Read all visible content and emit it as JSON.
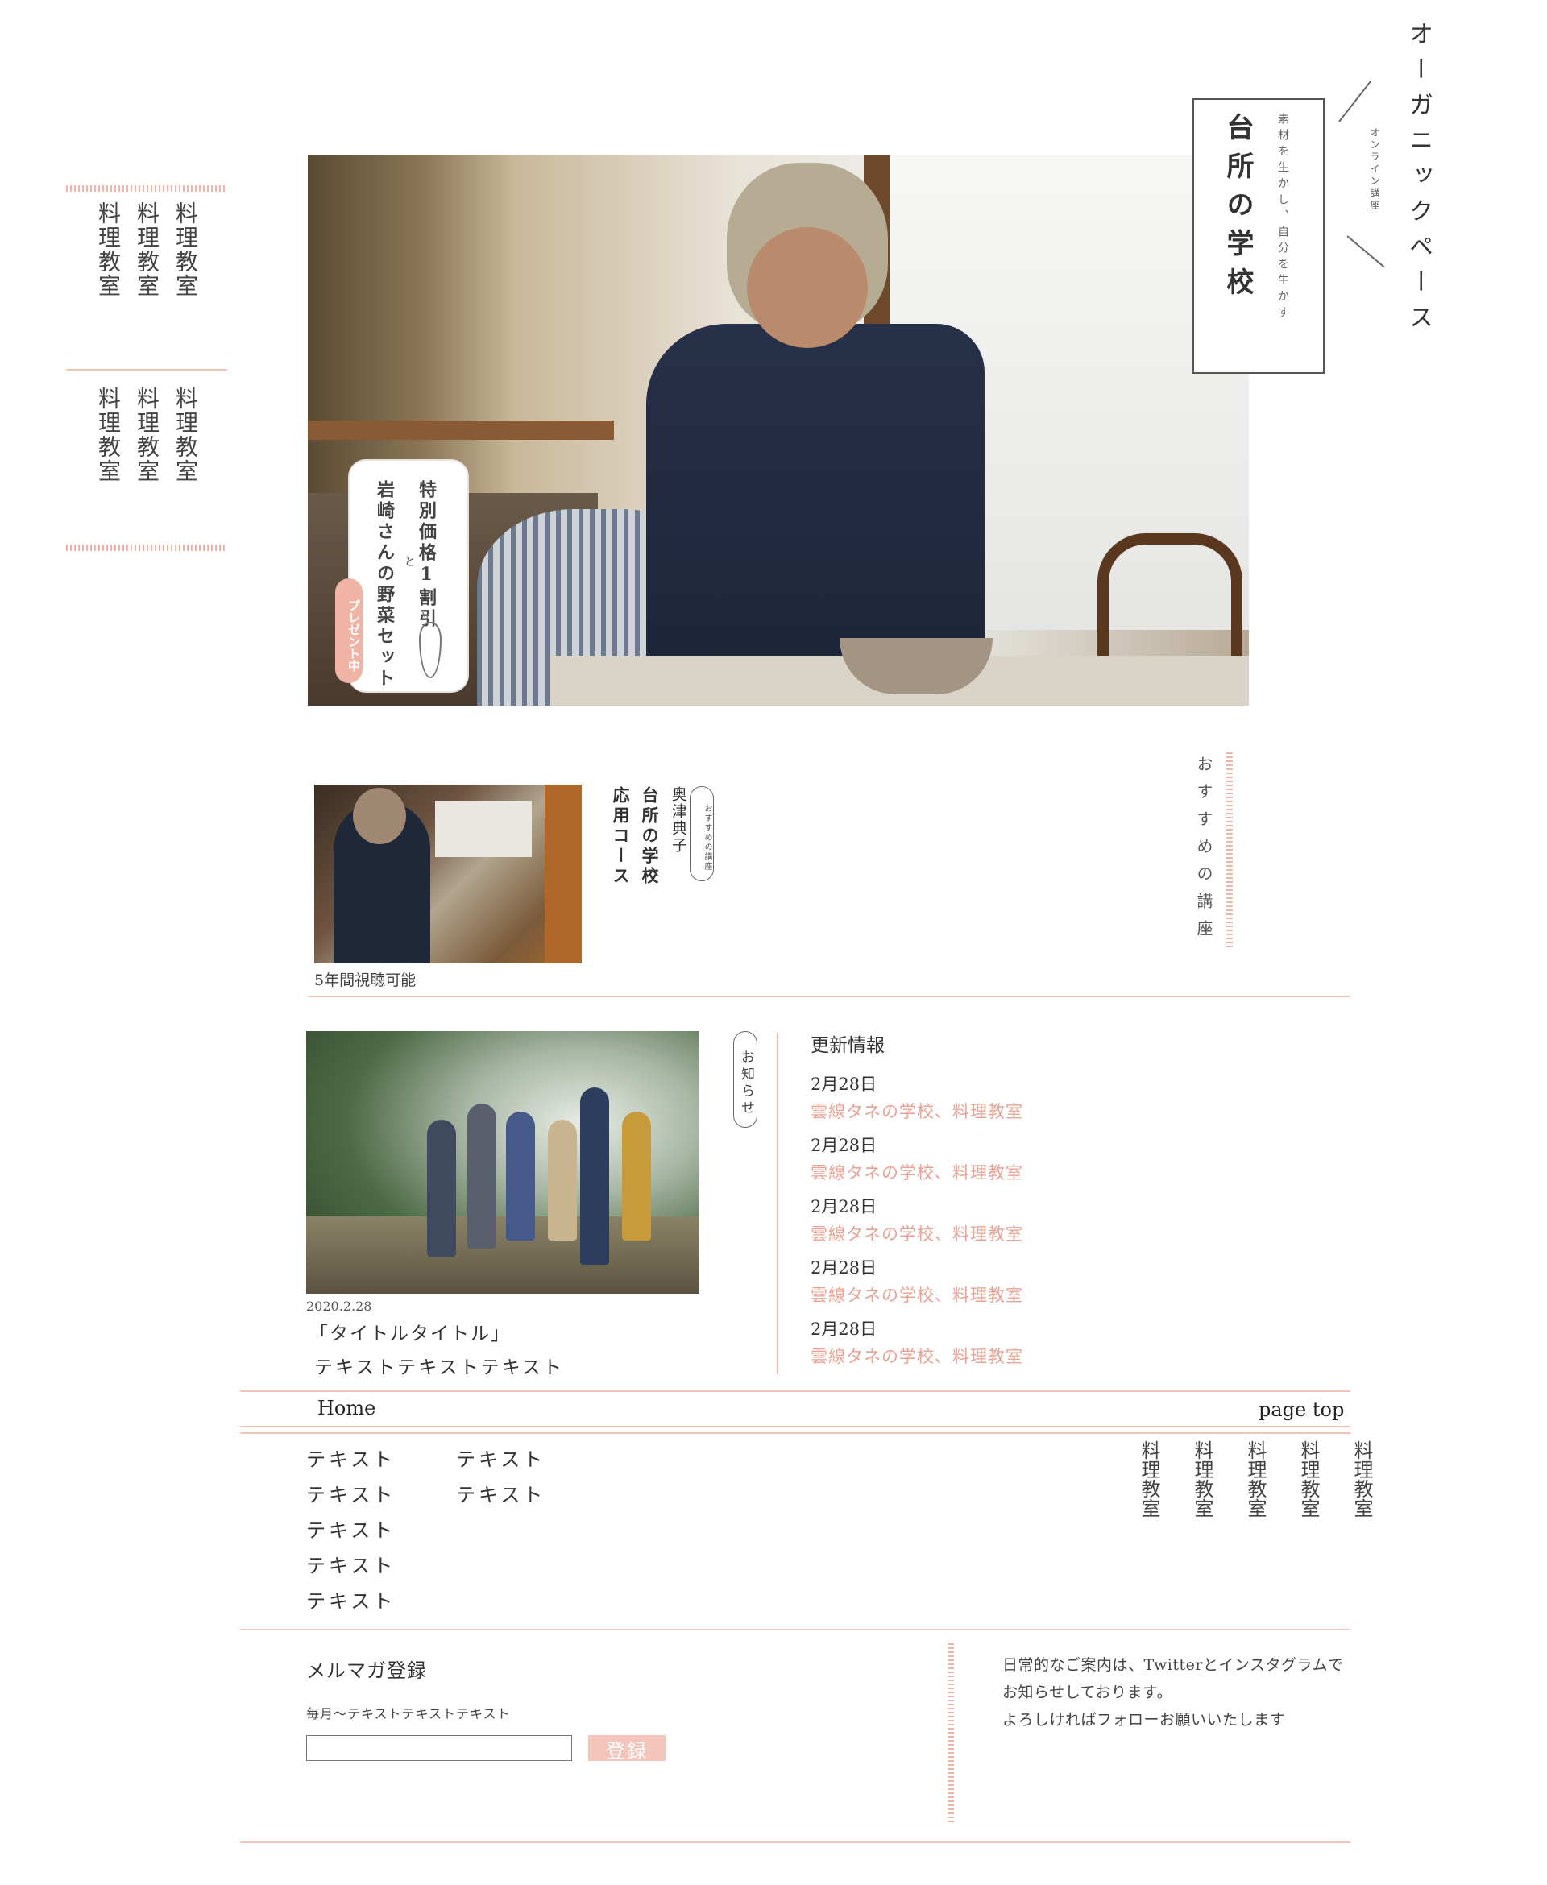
{
  "brand": {
    "name": "オーガニックペース",
    "logo_title": "台所の学校",
    "logo_subtitle": "素材を生かし、自分を生かす",
    "logo_tag": "オンライン講座"
  },
  "hero": {
    "promo_line1": "特別価格1割引",
    "promo_and": "と",
    "promo_line2": "岩崎さんの野菜セット",
    "promo_badge": "プレゼント中"
  },
  "left_menu": {
    "group1": [
      "料理教室",
      "料理教室",
      "料理教室"
    ],
    "group2": [
      "料理教室",
      "料理教室",
      "料理教室"
    ]
  },
  "recommended": {
    "section_label": "おすすめの講座",
    "tag": "おすすめの講座",
    "instructor": "奥津典子",
    "school": "台所の学校",
    "course": "応用コース",
    "caption": "5年間視聴可能"
  },
  "news": {
    "label": "お知らせ",
    "date": "2020.2.28",
    "title": "「タイトルタイトル」",
    "text": "テキストテキストテキスト"
  },
  "updates": {
    "heading": "更新情報",
    "items": [
      {
        "date": "2月28日",
        "link": "雲線タネの学校、料理教室"
      },
      {
        "date": "2月28日",
        "link": "雲線タネの学校、料理教室"
      },
      {
        "date": "2月28日",
        "link": "雲線タネの学校、料理教室"
      },
      {
        "date": "2月28日",
        "link": "雲線タネの学校、料理教室"
      },
      {
        "date": "2月28日",
        "link": "雲線タネの学校、料理教室"
      }
    ]
  },
  "footer": {
    "home": "Home",
    "page_top": "page top",
    "col1": [
      "テキスト",
      "テキスト",
      "テキスト",
      "テキスト",
      "テキスト"
    ],
    "col2": [
      "テキスト",
      "テキスト"
    ],
    "right_menu": [
      "料理教室",
      "料理教室",
      "料理教室",
      "料理教室",
      "料理教室"
    ]
  },
  "newsletter": {
    "title": "メルマガ登録",
    "desc": "毎月〜テキストテキストテキスト",
    "input_value": "",
    "button": "登録"
  },
  "sns": {
    "line1": "日常的なご案内は、Twitterとインスタグラムで",
    "line2": "お知らせしております。",
    "line3": "よろしければフォローお願いいたします"
  },
  "colors": {
    "accent": "#e8a394",
    "line": "#f3c3b8"
  }
}
